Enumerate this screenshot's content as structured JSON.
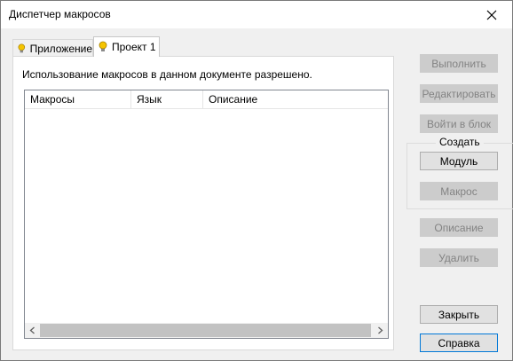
{
  "window": {
    "title": "Диспетчер макросов"
  },
  "tabs": [
    {
      "label": "Приложение",
      "active": false
    },
    {
      "label": "Проект 1",
      "active": true
    }
  ],
  "panel": {
    "info_text": "Использование макросов в данном документе разрешено.",
    "columns": [
      "Макросы",
      "Язык",
      "Описание"
    ],
    "rows": []
  },
  "buttons": {
    "run": {
      "label": "Выполнить",
      "enabled": false
    },
    "edit": {
      "label": "Редактировать",
      "enabled": false
    },
    "step_into": {
      "label": "Войти в блок",
      "enabled": false
    },
    "create_group_label": "Создать",
    "module": {
      "label": "Модуль",
      "enabled": true
    },
    "macro": {
      "label": "Макрос",
      "enabled": false
    },
    "description": {
      "label": "Описание",
      "enabled": false
    },
    "delete": {
      "label": "Удалить",
      "enabled": false
    },
    "close": {
      "label": "Закрыть",
      "enabled": true
    },
    "help": {
      "label": "Справка",
      "enabled": true
    }
  },
  "icons": {
    "tab_icon": "lightbulb-icon",
    "close": "close-icon"
  },
  "colors": {
    "focus_border": "#0078d7",
    "disabled_text": "#838383",
    "bulb": "#f5c400"
  }
}
